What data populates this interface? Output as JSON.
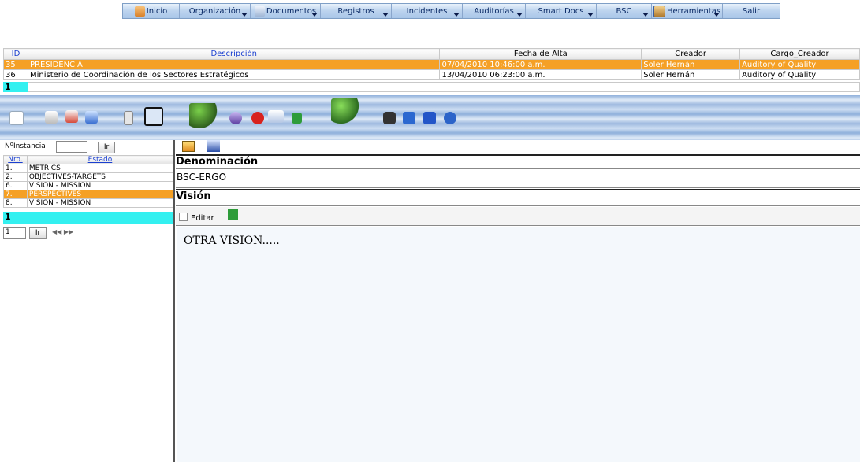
{
  "menu": {
    "items": [
      {
        "label": "Inicio"
      },
      {
        "label": "Organización"
      },
      {
        "label": "Documentos"
      },
      {
        "label": "Registros"
      },
      {
        "label": "Incidentes"
      },
      {
        "label": "Auditorías"
      },
      {
        "label": "Smart Docs"
      },
      {
        "label": "BSC"
      },
      {
        "label": "Herramientas"
      },
      {
        "label": "Salir"
      }
    ]
  },
  "topgrid": {
    "headers": {
      "id": "ID",
      "desc": "Descripción",
      "fecha": "Fecha de Alta",
      "creador": "Creador",
      "cargo": "Cargo_Creador"
    },
    "rows": [
      {
        "id": "35",
        "desc": "PRESIDENCIA",
        "fecha": "07/04/2010 10:46:00 a.m.",
        "creador": "Soler Hernán",
        "cargo": "Auditory of Quality"
      },
      {
        "id": "36",
        "desc": "Ministerio de Coordinación de los Sectores Estratégicos",
        "fecha": "13/04/2010 06:23:00 a.m.",
        "creador": "Soler Hernán",
        "cargo": "Auditory of Quality"
      }
    ],
    "page": "1"
  },
  "left": {
    "instancia_label": "NºInstancia",
    "ir_label": "Ir",
    "headers": {
      "nro": "Nro.",
      "estado": "Estado"
    },
    "rows": [
      {
        "nro": "1.",
        "estado": "METRICS"
      },
      {
        "nro": "2.",
        "estado": "OBJECTIVES-TARGETS"
      },
      {
        "nro": "6.",
        "estado": "VISION - MISSION"
      },
      {
        "nro": "7.",
        "estado": "PERSPECTIVES"
      },
      {
        "nro": "8.",
        "estado": "VISION - MISSION"
      }
    ],
    "page": "1",
    "page_input": "1",
    "nav_arrows": "◀◀ ▶▶"
  },
  "right": {
    "denominacion_title": "Denominación",
    "denominacion_value": "BSC-ERGO",
    "vision_title": "Visión",
    "editar_label": "Editar",
    "vision_text": "OTRA VISION....."
  }
}
